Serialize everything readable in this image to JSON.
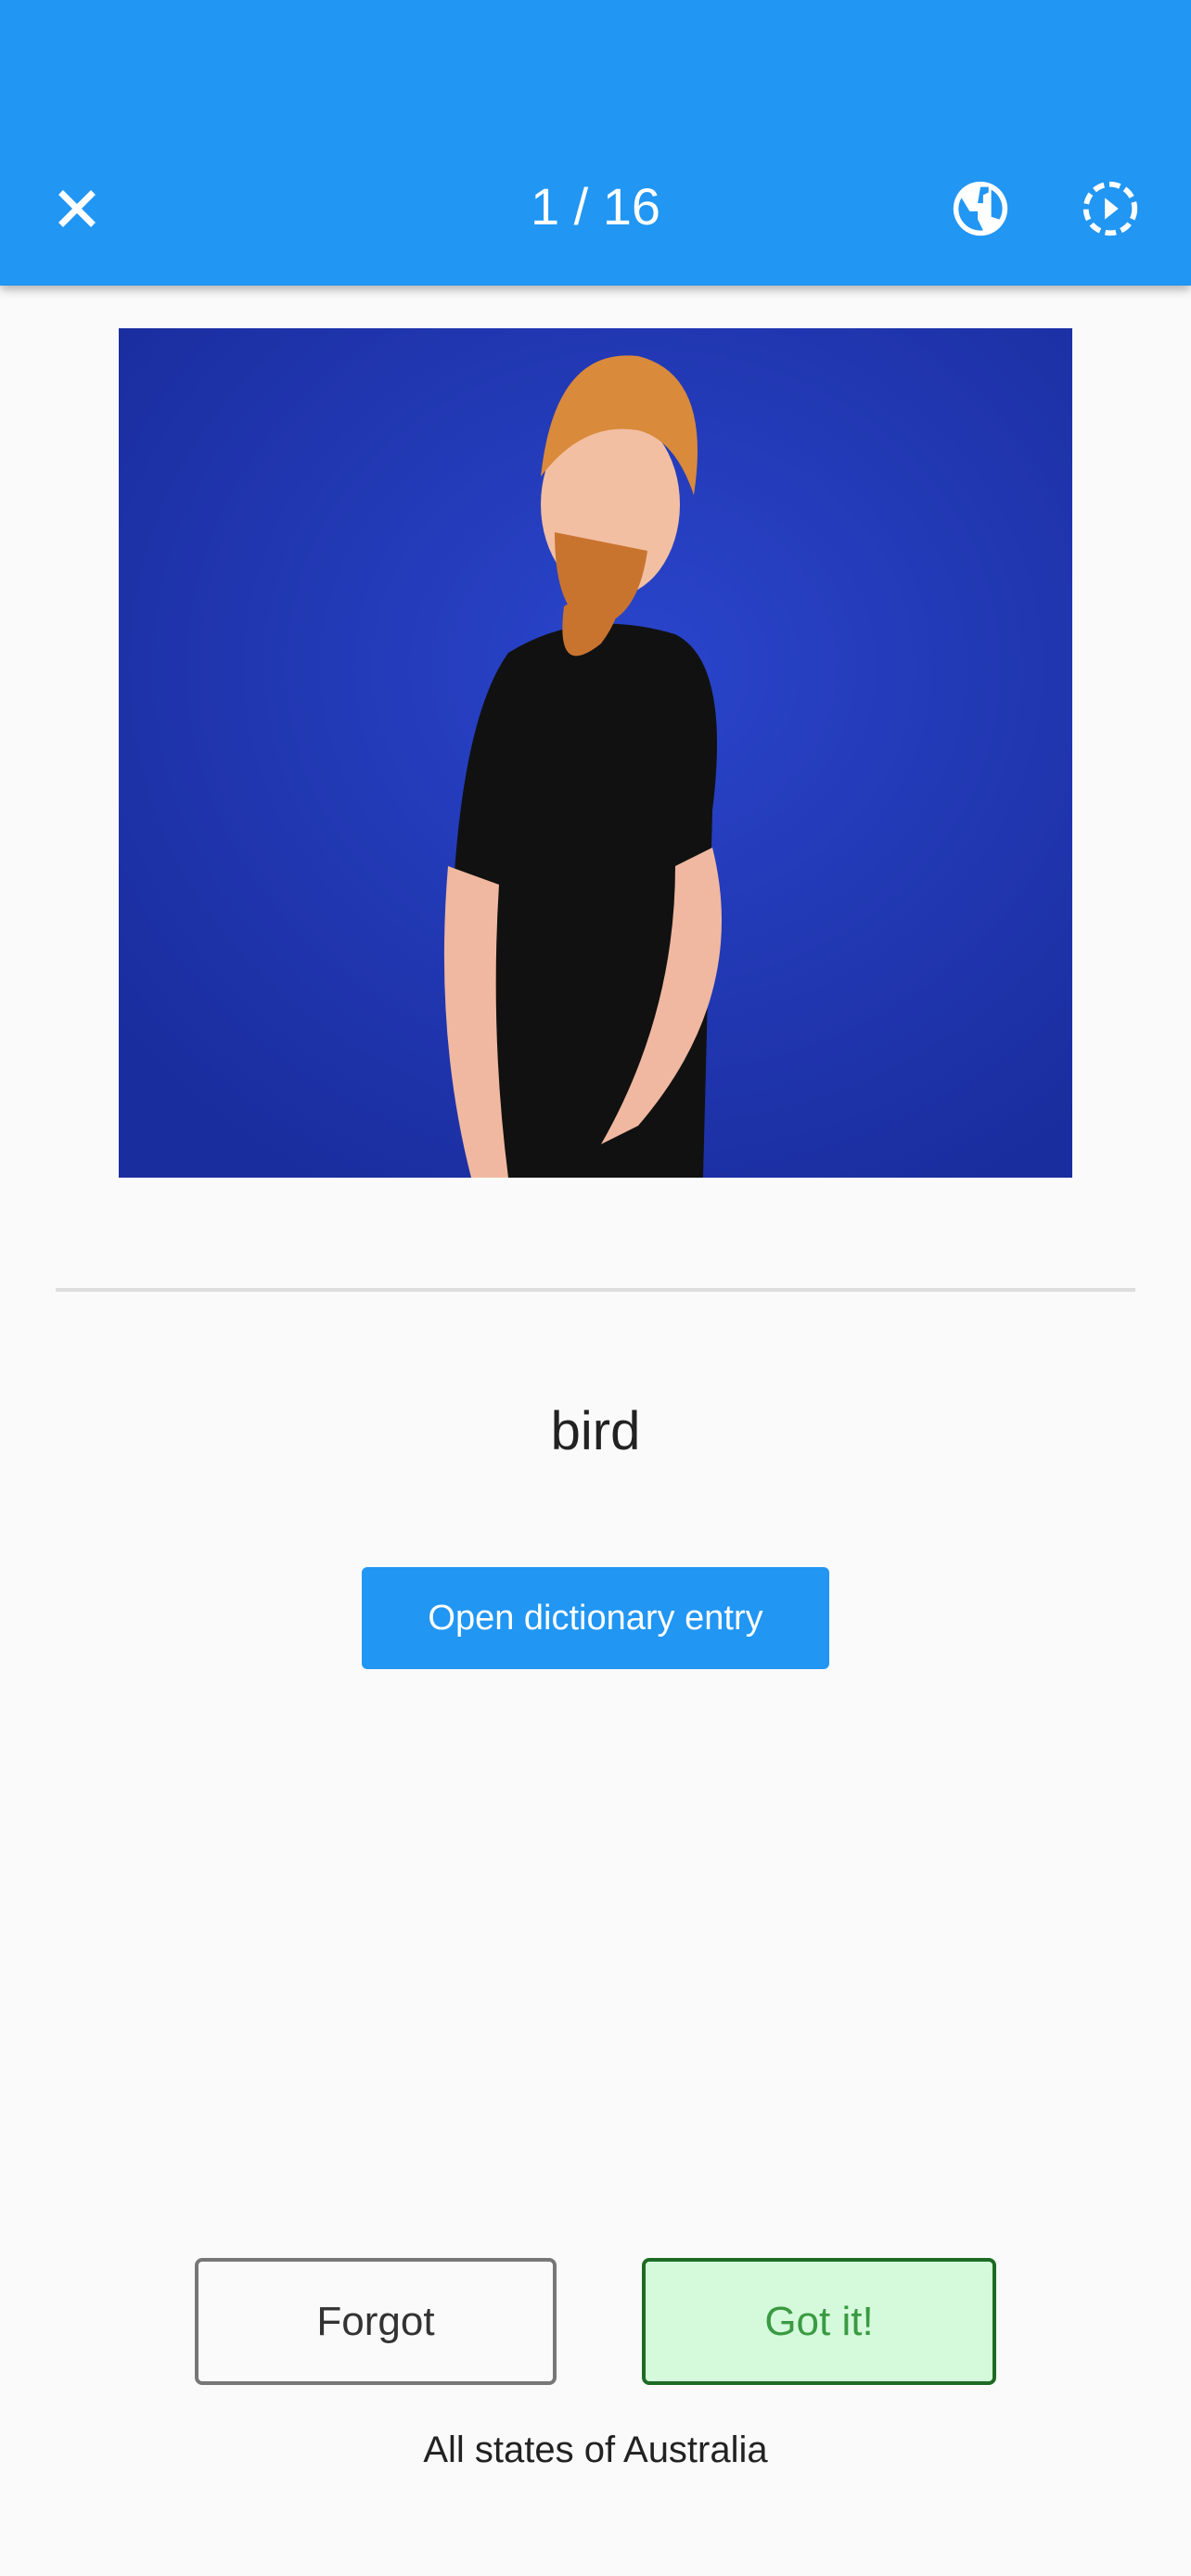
{
  "header": {
    "title": "1 / 16",
    "close_icon": "close-icon",
    "globe_icon": "globe-icon",
    "autoplay_icon": "autoplay-icon"
  },
  "card": {
    "word": "bird",
    "dictionary_button": "Open dictionary entry"
  },
  "actions": {
    "forgot": "Forgot",
    "got_it": "Got it!"
  },
  "footer": {
    "region": "All states of Australia"
  },
  "colors": {
    "primary": "#2196f3",
    "success_bg": "#d4fadb",
    "success_border": "#1e6b24"
  }
}
